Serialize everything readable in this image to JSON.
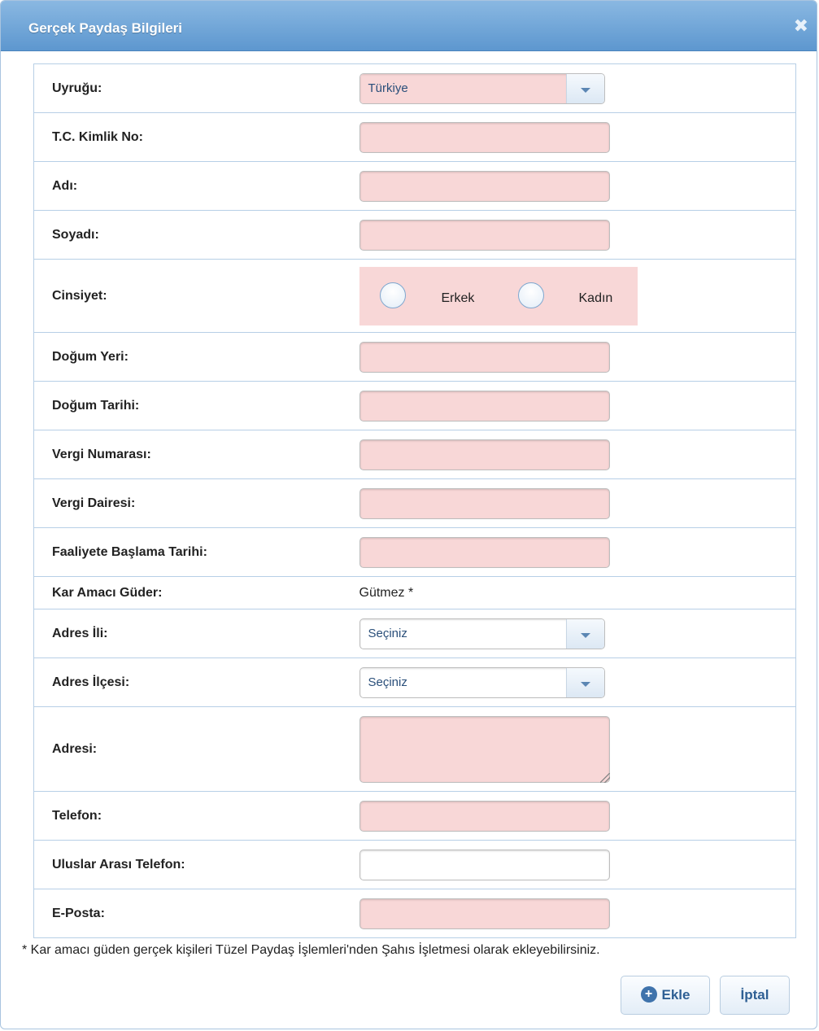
{
  "dialog": {
    "title": "Gerçek Paydaş Bilgileri",
    "close_glyph": "✖"
  },
  "fields": {
    "uyruk": {
      "label": "Uyruğu:",
      "value": "Türkiye"
    },
    "tckn": {
      "label": "T.C. Kimlik No:",
      "value": ""
    },
    "adi": {
      "label": "Adı:",
      "value": ""
    },
    "soyadi": {
      "label": "Soyadı:",
      "value": ""
    },
    "cinsiyet": {
      "label": "Cinsiyet:",
      "options": [
        "Erkek",
        "Kadın"
      ]
    },
    "dogum_yeri": {
      "label": "Doğum Yeri:",
      "value": ""
    },
    "dogum_tarihi": {
      "label": "Doğum Tarihi:",
      "value": ""
    },
    "vergi_no": {
      "label": "Vergi Numarası:",
      "value": ""
    },
    "vergi_dairesi": {
      "label": "Vergi Dairesi:",
      "value": ""
    },
    "faaliyet_tarihi": {
      "label": "Faaliyete Başlama Tarihi:",
      "value": ""
    },
    "kar_amaci": {
      "label": "Kar Amacı Güder:",
      "value": "Gütmez *"
    },
    "adres_il": {
      "label": "Adres İli:",
      "value": "Seçiniz"
    },
    "adres_ilce": {
      "label": "Adres İlçesi:",
      "value": "Seçiniz"
    },
    "adres": {
      "label": "Adresi:",
      "value": ""
    },
    "telefon": {
      "label": "Telefon:",
      "value": ""
    },
    "uluslararasi_telefon": {
      "label": "Uluslar Arası Telefon:",
      "value": ""
    },
    "eposta": {
      "label": "E-Posta:",
      "value": ""
    }
  },
  "footnote": "* Kar amacı güden gerçek kişileri Tüzel Paydaş İşlemleri'nden Şahıs İşletmesi olarak ekleyebilirsiniz.",
  "buttons": {
    "add": "Ekle",
    "cancel": "İptal"
  },
  "colors": {
    "required_field_bg": "#f8d7d7",
    "title_bar": "#6fa3d6",
    "button_text": "#2e5f94"
  },
  "icons": {
    "add_button_icon": "plus-circle-icon",
    "close_icon": "close-icon",
    "dropdown_icon": "chevron-down-icon"
  }
}
